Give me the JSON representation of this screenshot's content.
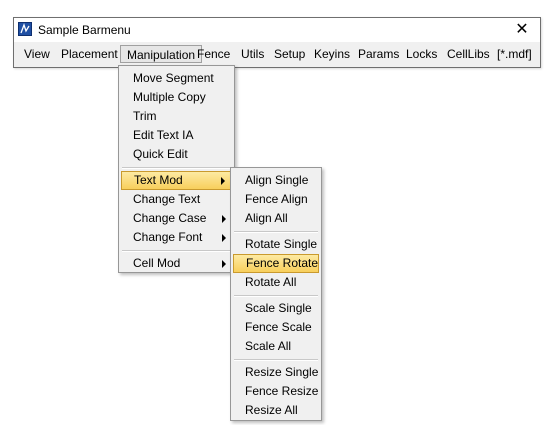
{
  "window": {
    "title": "Sample Barmenu",
    "close_glyph": "✕",
    "icon": "bentley-app-icon"
  },
  "menubar": {
    "items": [
      "View",
      "Placement",
      "Manipulation",
      "Fence",
      "Utils",
      "Setup",
      "Keyins",
      "Params",
      "Locks",
      "CellLibs",
      "[*.mdf]"
    ],
    "active": "Manipulation"
  },
  "manipulation_menu": {
    "items": [
      "Move Segment",
      "Multiple Copy",
      "Trim",
      "Edit Text IA",
      "Quick Edit",
      "Text Mod",
      "Change Text",
      "Change Case",
      "Change Font",
      "Cell Mod"
    ],
    "highlighted": "Text Mod",
    "submenu_items": [
      "Text Mod",
      "Change Case",
      "Change Font",
      "Cell Mod"
    ]
  },
  "text_mod_menu": {
    "items": [
      "Align Single",
      "Fence Align",
      "Align All",
      "Rotate Single",
      "Fence Rotate",
      "Rotate All",
      "Scale Single",
      "Fence Scale",
      "Scale All",
      "Resize Single",
      "Fence Resize",
      "Resize All"
    ],
    "highlighted": "Fence Rotate"
  },
  "colors": {
    "highlight_top": "#fdeaa3",
    "highlight_bottom": "#f8cf5c",
    "highlight_border": "#c99a2e",
    "menu_bg": "#f0f0f0"
  }
}
